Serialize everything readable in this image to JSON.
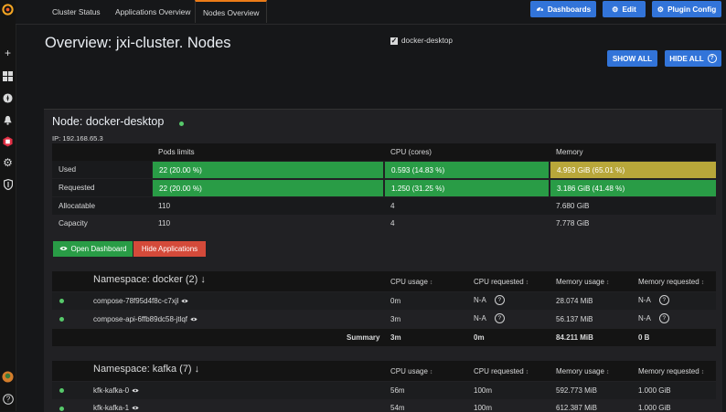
{
  "tabs": [
    "Cluster Status",
    "Applications Overview",
    "Nodes Overview"
  ],
  "toolbar": {
    "dashboards": "Dashboards",
    "edit": "Edit",
    "plugin_config": "Plugin Config"
  },
  "page_title": "Overview: jxi-cluster. Nodes",
  "filter": {
    "label": "docker-desktop",
    "checked": true
  },
  "actions": {
    "show_all": "SHOW ALL",
    "hide_all": "HIDE ALL"
  },
  "node": {
    "title": "Node: docker-desktop",
    "ip": "IP: 192.168.65.3",
    "columns": [
      "Pods limits",
      "CPU (cores)",
      "Memory"
    ],
    "rows": [
      {
        "label": "Used",
        "pods": "22 (20.00 %)",
        "cpu": "0.593 (14.83 %)",
        "mem": "4.993 GiB (65.01 %)"
      },
      {
        "label": "Requested",
        "pods": "22 (20.00 %)",
        "cpu": "1.250 (31.25 %)",
        "mem": "3.186 GiB (41.48 %)"
      },
      {
        "label": "Allocatable",
        "pods": "110",
        "cpu": "4",
        "mem": "7.680 GiB"
      },
      {
        "label": "Capacity",
        "pods": "110",
        "cpu": "4",
        "mem": "7.778 GiB"
      }
    ],
    "open_dashboard": "Open Dashboard",
    "hide_applications": "Hide Applications"
  },
  "ns_columns": [
    "CPU usage",
    "CPU requested",
    "Memory usage",
    "Memory requested"
  ],
  "namespaces": [
    {
      "title": "Namespace: docker (2)",
      "pods": [
        {
          "name": "compose-78f95d4f8c-c7xjl",
          "cpu": "0m",
          "cpu_req": "N-A",
          "mem": "28.074 MiB",
          "mem_req": "N-A"
        },
        {
          "name": "compose-api-6ffb89dc58-jtlqf",
          "cpu": "3m",
          "cpu_req": "N-A",
          "mem": "56.137 MiB",
          "mem_req": "N-A"
        }
      ],
      "summary": {
        "label": "Summary",
        "cpu": "3m",
        "cpu_req": "0m",
        "mem": "84.211 MiB",
        "mem_req": "0 B"
      }
    },
    {
      "title": "Namespace: kafka (7)",
      "pods": [
        {
          "name": "kfk-kafka-0",
          "cpu": "56m",
          "cpu_req": "100m",
          "mem": "592.773 MiB",
          "mem_req": "1.000 GiB"
        },
        {
          "name": "kfk-kafka-1",
          "cpu": "54m",
          "cpu_req": "100m",
          "mem": "612.387 MiB",
          "mem_req": "1.000 GiB"
        }
      ]
    }
  ]
}
